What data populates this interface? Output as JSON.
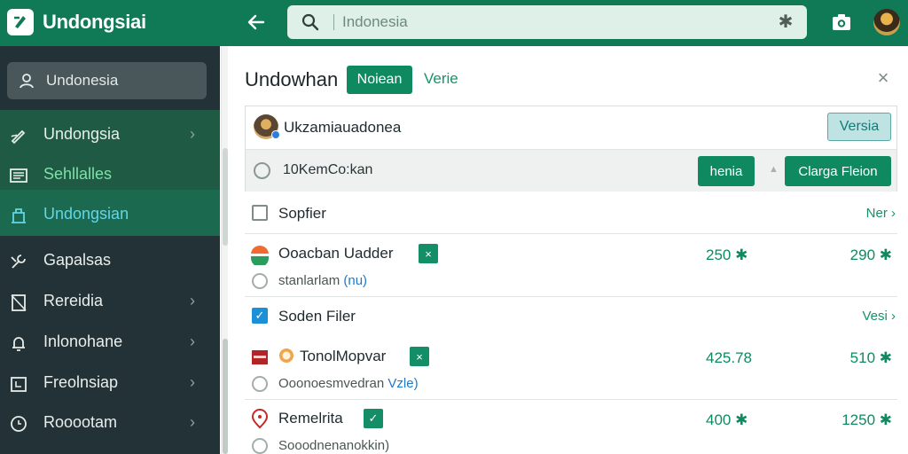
{
  "app": {
    "title": "Undongsiai"
  },
  "search": {
    "placeholder": "Indonesia"
  },
  "sidebar": {
    "search_label": "Undonesia",
    "items": [
      {
        "label": "Undongsia",
        "icon": "edit-icon",
        "chevron": "›"
      },
      {
        "label": "Sehllalles",
        "icon": "list-icon",
        "chevron": ""
      },
      {
        "label": "Undongsian",
        "icon": "building-icon",
        "chevron": ""
      },
      {
        "label": "Gapalsas",
        "icon": "tools-icon",
        "chevron": ""
      },
      {
        "label": "Rereidia",
        "icon": "document-icon",
        "chevron": "›"
      },
      {
        "label": "Inlonohane",
        "icon": "bell-icon",
        "chevron": "›"
      },
      {
        "label": "Freolnsiap",
        "icon": "inbox-icon",
        "chevron": "›"
      },
      {
        "label": "Rooootam",
        "icon": "clock-icon",
        "chevron": "›"
      }
    ]
  },
  "panel": {
    "title": "Undowhan",
    "chip_active": "Noiean",
    "chip_plain": "Verie",
    "close": "×"
  },
  "card": {
    "user_name": "Ukzamiauadonea",
    "versia_button": "Versia",
    "radio_label": "10KemCo:kan",
    "btn_a": "henia",
    "btn_b": "Clarga Fleion"
  },
  "sections": [
    {
      "label": "Sopfier",
      "link": "Ner ›",
      "checked": false
    },
    {
      "label": "Soden Filer",
      "link": "Vesi ›",
      "checked": true
    }
  ],
  "rows": [
    {
      "title": "Ooacban Uadder",
      "sub": "stanlarlam ",
      "sub_hl": "(nu)",
      "v1": "250 ✱",
      "v2": "290 ✱",
      "tag": "×"
    },
    {
      "title": "TonolMopvar",
      "sub": "Ooonoesmvedran ",
      "sub_hl": "Vzle)",
      "v1": "425.78",
      "v2": "510 ✱",
      "tag": "×"
    },
    {
      "title": "Remelrita",
      "sub": "Sooodnenanokkin)",
      "sub_hl": "",
      "v1": "400 ✱",
      "v2": "1250 ✱",
      "tag": "✓"
    }
  ],
  "colors": {
    "brand": "#0f7a55",
    "sidebar": "#233236",
    "accent": "#0f8a60"
  }
}
